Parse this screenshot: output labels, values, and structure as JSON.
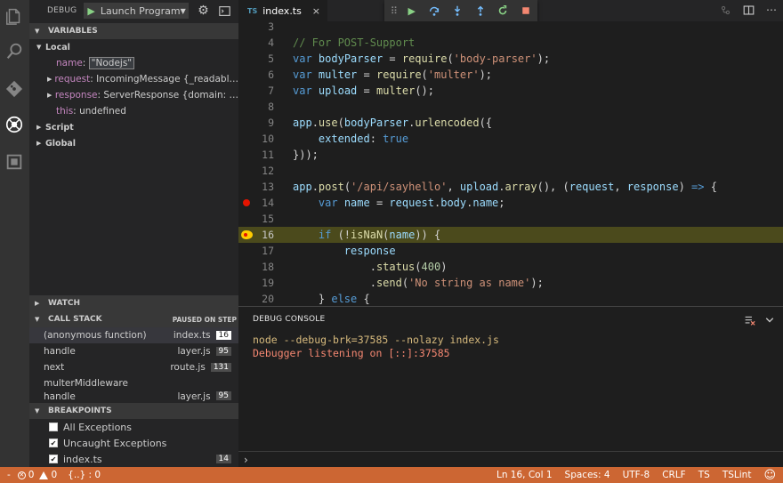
{
  "sidebar": {
    "debug_title": "DEBUG",
    "launch_config": "Launch Program",
    "variables": {
      "header": "VARIABLES",
      "local_label": "Local",
      "items": [
        {
          "name": "name",
          "value": "\"Nodejs\""
        },
        {
          "name": "request",
          "value": "IncomingMessage {_readabl…"
        },
        {
          "name": "response",
          "value": "ServerResponse {domain: …"
        },
        {
          "name": "this",
          "value": "undefined"
        }
      ],
      "script_label": "Script",
      "global_label": "Global"
    },
    "watch": {
      "header": "WATCH"
    },
    "call_stack": {
      "header": "CALL STACK",
      "status": "PAUSED ON STEP",
      "frames": [
        {
          "fn": "(anonymous function)",
          "file": "index.ts",
          "line": "16"
        },
        {
          "fn": "handle",
          "file": "layer.js",
          "line": "95"
        },
        {
          "fn": "next",
          "file": "route.js",
          "line": "131"
        },
        {
          "fn": "multerMiddleware",
          "file": "",
          "line": ""
        },
        {
          "fn": "handle",
          "file": "layer.js",
          "line": "95"
        }
      ]
    },
    "breakpoints": {
      "header": "BREAKPOINTS",
      "items": [
        {
          "label": "All Exceptions",
          "checked": false,
          "line": ""
        },
        {
          "label": "Uncaught Exceptions",
          "checked": true,
          "line": ""
        },
        {
          "label": "index.ts",
          "checked": true,
          "line": "14"
        }
      ]
    }
  },
  "tab": {
    "lang": "TS",
    "name": "index.ts",
    "close": "×"
  },
  "editor": {
    "lines": [
      {
        "n": "3"
      },
      {
        "n": "4"
      },
      {
        "n": "5"
      },
      {
        "n": "6"
      },
      {
        "n": "7"
      },
      {
        "n": "8"
      },
      {
        "n": "9"
      },
      {
        "n": "10"
      },
      {
        "n": "11"
      },
      {
        "n": "12"
      },
      {
        "n": "13"
      },
      {
        "n": "14"
      },
      {
        "n": "15"
      },
      {
        "n": "16"
      },
      {
        "n": "17"
      },
      {
        "n": "18"
      },
      {
        "n": "19"
      },
      {
        "n": "20"
      }
    ],
    "code": {
      "l4_comment": "// For POST-Support",
      "l5_kw": "var",
      "l5_var": "bodyParser",
      "l5_eq": " = ",
      "l5_fn": "require",
      "l5_p1": "(",
      "l5_str": "'body-parser'",
      "l5_p2": ");",
      "l6_kw": "var",
      "l6_var": "multer",
      "l6_eq": " = ",
      "l6_fn": "require",
      "l6_p1": "(",
      "l6_str": "'multer'",
      "l6_p2": ");",
      "l7_kw": "var",
      "l7_var": "upload",
      "l7_eq": " = ",
      "l7_fn": "multer",
      "l7_p": "();",
      "l9_var": "app",
      "l9_dot": ".",
      "l9_fn": "use",
      "l9_p1": "(",
      "l9_var2": "bodyParser",
      "l9_dot2": ".",
      "l9_fn2": "urlencoded",
      "l9_p2": "({",
      "l10_var": "extended",
      "l10_colon": ": ",
      "l10_kw": "true",
      "l11_txt": "}));",
      "l13_var": "app",
      "l13_dot": ".",
      "l13_fn": "post",
      "l13_p1": "(",
      "l13_str": "'/api/sayhello'",
      "l13_c1": ", ",
      "l13_var2": "upload",
      "l13_dot2": ".",
      "l13_fn2": "array",
      "l13_p2": "(), (",
      "l13_var3": "request",
      "l13_c2": ", ",
      "l13_var4": "response",
      "l13_p3": ") ",
      "l13_arrow": "=>",
      "l13_br": " {",
      "l14_kw": "var",
      "l14_var": "name",
      "l14_eq": " = ",
      "l14_var2": "request",
      "l14_dot": ".",
      "l14_var3": "body",
      "l14_dot2": ".",
      "l14_var4": "name",
      "l14_semi": ";",
      "l16_kw": "if",
      "l16_p1": " (!",
      "l16_fn": "isNaN",
      "l16_p2": "(",
      "l16_var": "name",
      "l16_p3": ")) {",
      "l17_var": "response",
      "l18_dot": ".",
      "l18_fn": "status",
      "l18_p1": "(",
      "l18_num": "400",
      "l18_p2": ")",
      "l19_dot": ".",
      "l19_fn": "send",
      "l19_p1": "(",
      "l19_str": "'No string as name'",
      "l19_p2": ");",
      "l20_br": "} ",
      "l20_kw": "else",
      "l20_br2": " {"
    }
  },
  "panel": {
    "title": "DEBUG CONSOLE",
    "output": [
      "node --debug-brk=37585 --nolazy index.js",
      "Debugger listening on [::]:37585"
    ],
    "prompt": "›"
  },
  "status": {
    "errors": "0",
    "warnings": "0",
    "braces": "{..} : 0",
    "position": "Ln 16, Col 1",
    "spaces": "Spaces: 4",
    "encoding": "UTF-8",
    "eol": "CRLF",
    "language": "TS",
    "linter": "TSLint"
  },
  "colors": {
    "status_bar": "#cc6633",
    "current_line": "#4b4a1c",
    "breakpoint": "#e51400",
    "console_output": "#d7ba7d"
  },
  "icons": [
    "files-icon",
    "search-icon",
    "git-icon",
    "debug-icon",
    "extensions-icon",
    "gear-icon",
    "terminal-icon",
    "play-icon",
    "step-over-icon",
    "step-into-icon",
    "step-out-icon",
    "restart-icon",
    "stop-icon",
    "split-editor-icon",
    "more-icon",
    "clear-console-icon",
    "collapse-panel-icon",
    "smiley-icon"
  ]
}
